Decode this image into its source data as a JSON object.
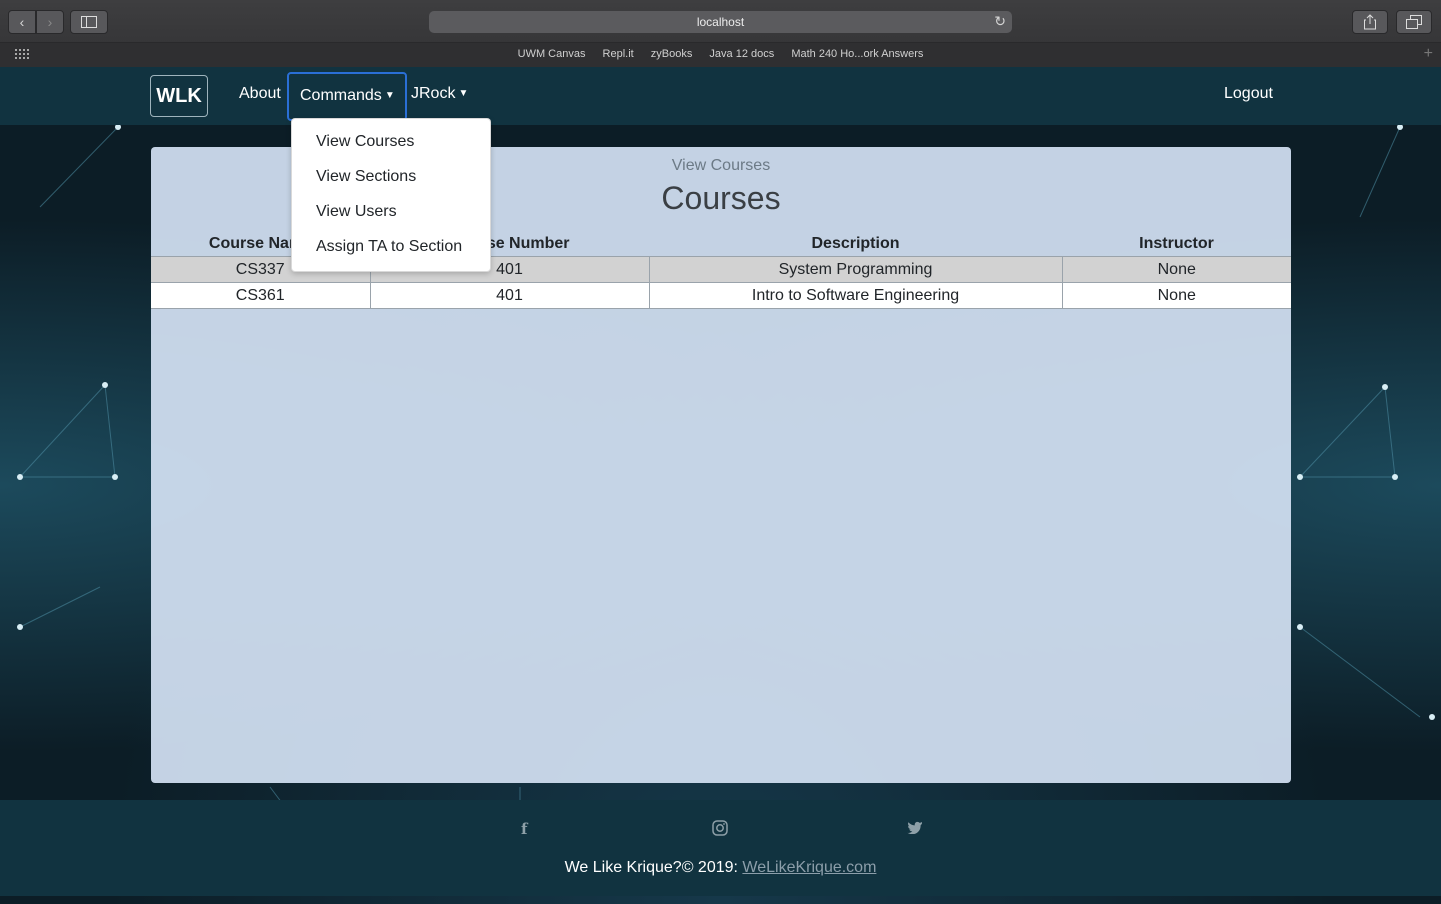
{
  "browser": {
    "url": "localhost",
    "bookmarks": [
      "UWM Canvas",
      "Repl.it",
      "zyBooks",
      "Java 12 docs",
      "Math 240 Ho...ork Answers"
    ]
  },
  "navbar": {
    "brand": "WLK",
    "about": "About",
    "commands": "Commands",
    "user": "JRock",
    "logout": "Logout"
  },
  "dropdown": {
    "items": [
      "View Courses",
      "View Sections",
      "View Users",
      "Assign TA to Section"
    ]
  },
  "main": {
    "subtitle": "View Courses",
    "title": "Courses",
    "table": {
      "headers": [
        "Course Name",
        "Course Number",
        "Description",
        "Instructor"
      ],
      "rows": [
        [
          "CS337",
          "401",
          "System Programming",
          "None"
        ],
        [
          "CS361",
          "401",
          "Intro to Software Engineering",
          "None"
        ]
      ]
    }
  },
  "footer": {
    "text": "We Like Krique?© 2019:",
    "link": "WeLikeKrique.com"
  },
  "colors": {
    "navbar": "#113340",
    "active_outline": "#2a6fd6",
    "card": "#d0def0"
  }
}
